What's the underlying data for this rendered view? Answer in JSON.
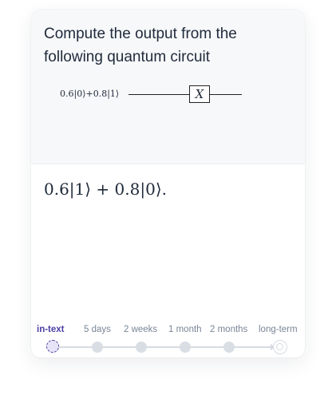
{
  "question": {
    "text": "Compute the output from the following quantum circuit",
    "circuit": {
      "input_state": "0.6|0⟩+0.8|1⟩",
      "gate": "X"
    }
  },
  "answer": {
    "text": "0.6|1⟩ + 0.8|0⟩."
  },
  "timeline": {
    "labels": [
      "in-text",
      "5 days",
      "2 weeks",
      "1 month",
      "2 months",
      "long-term"
    ],
    "active_index": 0
  },
  "colors": {
    "accent": "#4b3fa3",
    "node": "#d9dee5",
    "track": "#d6dbe2",
    "question_bg": "#f7f8fa"
  }
}
